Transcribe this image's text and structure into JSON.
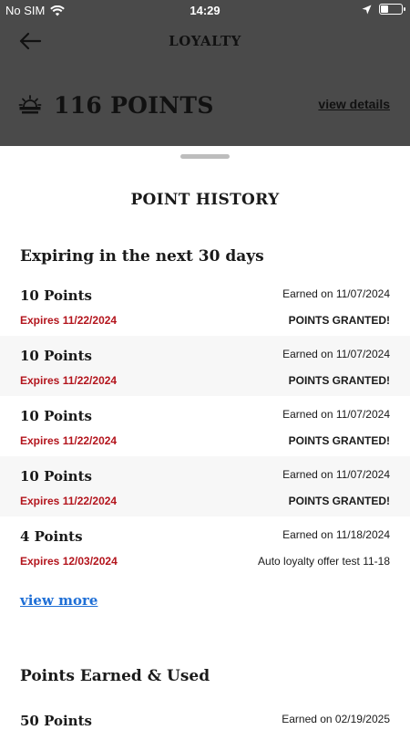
{
  "status_bar": {
    "carrier": "No SIM",
    "time": "14:29"
  },
  "header": {
    "title": "LOYALTY"
  },
  "summary": {
    "points_total": "116 POINTS",
    "view_details_label": "view details"
  },
  "sheet": {
    "title": "POINT HISTORY",
    "expiring_heading": "Expiring in the next 30 days",
    "expiring": [
      {
        "points": "10 Points",
        "earned": "Earned on 11/07/2024",
        "expires": "Expires 11/22/2024",
        "status": "POINTS GRANTED!"
      },
      {
        "points": "10 Points",
        "earned": "Earned on 11/07/2024",
        "expires": "Expires 11/22/2024",
        "status": "POINTS GRANTED!"
      },
      {
        "points": "10 Points",
        "earned": "Earned on 11/07/2024",
        "expires": "Expires 11/22/2024",
        "status": "POINTS GRANTED!"
      },
      {
        "points": "10 Points",
        "earned": "Earned on 11/07/2024",
        "expires": "Expires 11/22/2024",
        "status": "POINTS GRANTED!"
      },
      {
        "points": "4 Points",
        "earned": "Earned on 11/18/2024",
        "expires": "Expires 12/03/2024",
        "status": "Auto loyalty offer test 11-18"
      }
    ],
    "view_more_label": "view more",
    "earned_heading": "Points Earned & Used",
    "earned": [
      {
        "points": "50 Points",
        "earned": "Earned on 02/19/2025"
      }
    ]
  },
  "colors": {
    "expires_red": "#b3141c",
    "link_blue": "#1f6fd6",
    "overlay": "#4a4a4a",
    "row_alt": "#f7f7f7"
  }
}
